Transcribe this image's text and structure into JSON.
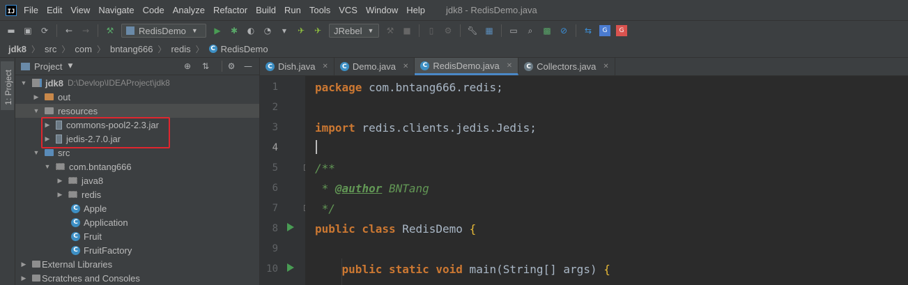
{
  "menubar": {
    "logo_letter": "IJ",
    "items": [
      "File",
      "Edit",
      "View",
      "Navigate",
      "Code",
      "Analyze",
      "Refactor",
      "Build",
      "Run",
      "Tools",
      "VCS",
      "Window",
      "Help"
    ],
    "window_title": "jdk8 - RedisDemo.java"
  },
  "toolbar": {
    "run_config": "RedisDemo",
    "jrebel": "JRebel",
    "icons": [
      "open-icon",
      "save-icon",
      "sync-icon",
      "back-icon",
      "forward-icon",
      "build-icon",
      "run-icon",
      "debug-icon",
      "coverage-icon",
      "profile-icon",
      "jrebel-run-icon",
      "jrebel-debug-icon",
      "stop-icon",
      "settings-icon",
      "structure-icon",
      "terminal-icon",
      "search-icon",
      "cpu-icon",
      "no-icon",
      "translate-icon",
      "google-icon"
    ]
  },
  "breadcrumb": [
    "jdk8",
    "src",
    "com",
    "bntang666",
    "redis",
    "RedisDemo"
  ],
  "sidebar_stripe": {
    "label": "1: Project"
  },
  "project": {
    "title": "Project",
    "root_name": "jdk8",
    "root_path": "D:\\Devlop\\IDEAProject\\jdk8",
    "tree": [
      {
        "label": "out"
      },
      {
        "label": "resources"
      },
      {
        "label": "commons-pool2-2.3.jar"
      },
      {
        "label": "jedis-2.7.0.jar"
      },
      {
        "label": "src"
      },
      {
        "label": "com.bntang666"
      },
      {
        "label": "java8"
      },
      {
        "label": "redis"
      },
      {
        "label": "Apple"
      },
      {
        "label": "Application"
      },
      {
        "label": "Fruit"
      },
      {
        "label": "FruitFactory"
      },
      {
        "label": "External Libraries"
      },
      {
        "label": "Scratches and Consoles"
      }
    ]
  },
  "tabs": [
    "Dish.java",
    "Demo.java",
    "RedisDemo.java",
    "Collectors.java"
  ],
  "editor": {
    "line_numbers": [
      "1",
      "2",
      "3",
      "4",
      "5",
      "6",
      "7",
      "8",
      "9",
      "10"
    ],
    "line1_kw": "package",
    "line1_rest": " com.bntang666.redis;",
    "line3_kw": "import",
    "line3_rest": " redis.clients.jedis.Jedis;",
    "line5": "/**",
    "line6_prefix": " * ",
    "line6_tag": "@author",
    "line6_rest": " BNTang",
    "line7": " */",
    "line8_kw": "public class",
    "line8_name": " RedisDemo ",
    "line8_brace": "{",
    "line10_kw": "    public static void",
    "line10_rest": " main(String[] args) ",
    "line10_brace": "{"
  }
}
